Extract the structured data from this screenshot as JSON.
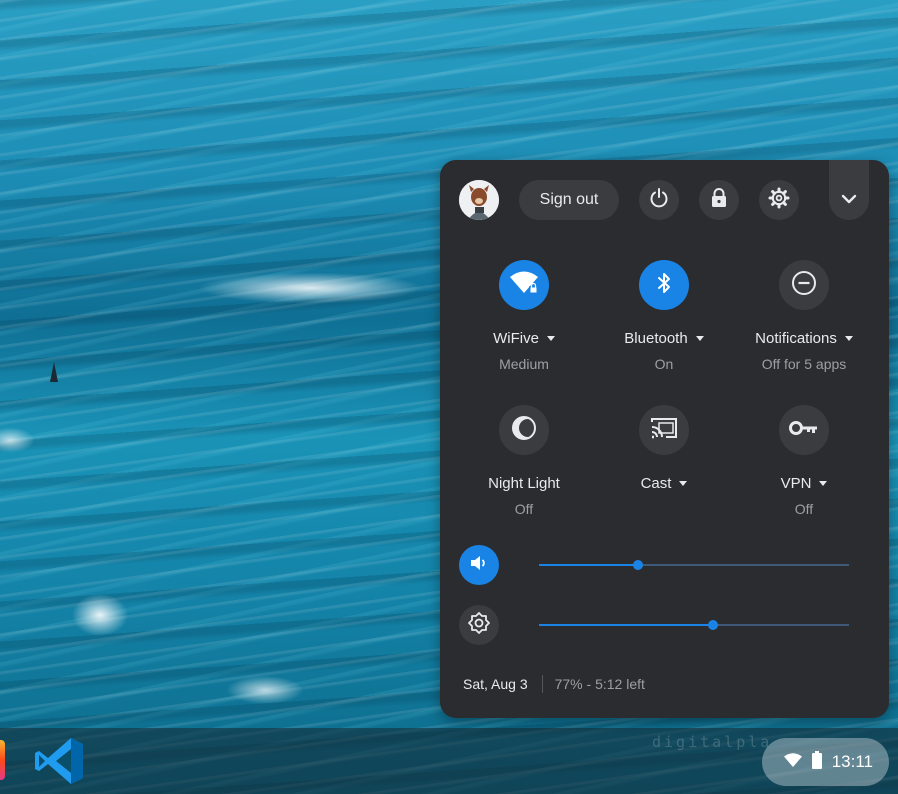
{
  "desktop": {
    "watermark": "digitalpla"
  },
  "shelf": {
    "apps": [
      {
        "name": "partial-app"
      },
      {
        "name": "Visual Studio Code",
        "icon": "vscode-icon",
        "color": "#23a9f2"
      }
    ],
    "status": {
      "time": "13:11",
      "icons": [
        "wifi-icon",
        "battery-icon"
      ]
    }
  },
  "quick_settings": {
    "header": {
      "sign_out_label": "Sign out",
      "buttons": [
        "power-icon",
        "lock-icon",
        "gear-icon",
        "chevron-down-icon"
      ]
    },
    "tiles": [
      {
        "label": "WiFive",
        "sub": "Medium",
        "icon": "wifi-lock-icon",
        "on": true,
        "has_menu": true
      },
      {
        "label": "Bluetooth",
        "sub": "On",
        "icon": "bluetooth-icon",
        "on": true,
        "has_menu": true
      },
      {
        "label": "Notifications",
        "sub": "Off for 5 apps",
        "icon": "do-not-disturb-icon",
        "on": false,
        "has_menu": true
      },
      {
        "label": "Night Light",
        "sub": "Off",
        "icon": "night-light-icon",
        "on": false,
        "has_menu": false
      },
      {
        "label": "Cast",
        "sub": "",
        "icon": "cast-icon",
        "on": false,
        "has_menu": true
      },
      {
        "label": "VPN",
        "sub": "Off",
        "icon": "vpn-key-icon",
        "on": false,
        "has_menu": true
      }
    ],
    "sliders": {
      "volume": {
        "icon": "volume-icon",
        "level": 0.32
      },
      "brightness": {
        "icon": "brightness-icon",
        "level": 0.56
      }
    },
    "footer": {
      "date": "Sat, Aug 3",
      "battery": "77% - 5:12 left"
    },
    "colors": {
      "panel_bg": "#2b2c2f",
      "accent": "#1a84e6",
      "button_bg": "#3b3c40",
      "text_primary": "#e8eaed",
      "text_secondary": "#9aa0a6"
    }
  }
}
